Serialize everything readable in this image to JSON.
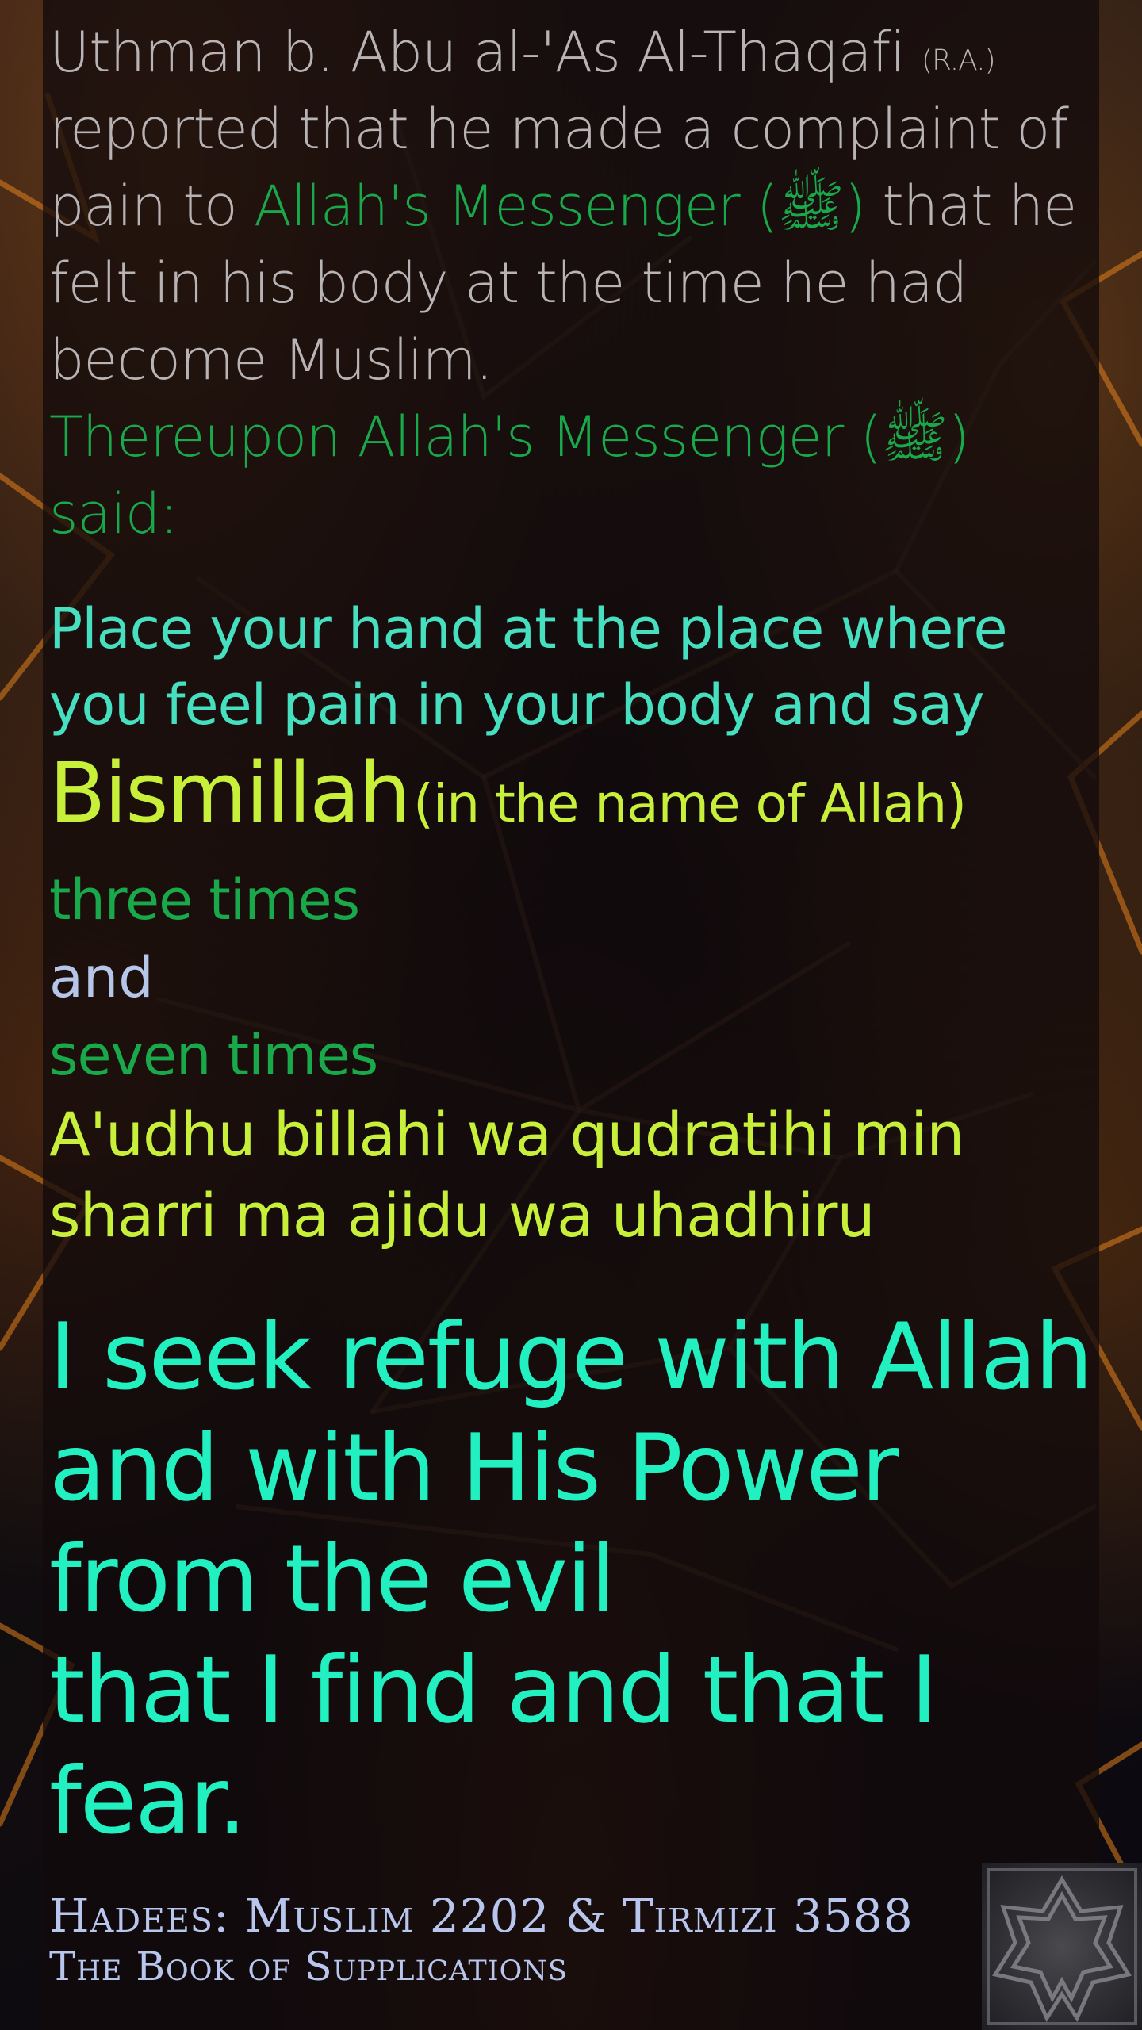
{
  "hadith": {
    "intro_a": "Uthman b. Abu al-'As Al-Thaqafi",
    "intro_honorific": "(R.A.)",
    "intro_b": "reported that he made a complaint of pain to",
    "messenger_1": "Allah's Messenger (ﷺ)",
    "intro_c": "that he felt in his body at the time he had become Muslim.",
    "thereupon": "Thereupon Allah's Messenger (ﷺ) said:",
    "instruction": "Place your hand at the place where you feel pain in your body and say",
    "bismillah": "Bismillah",
    "bismillah_meaning": "(in the name of Allah)",
    "count_1": "three times",
    "and": "and",
    "count_2": "seven times",
    "transliteration": "A'udhu billahi wa qudratihi min sharri ma ajidu wa uhadhiru",
    "meaning_line_1": "I seek refuge with Allah",
    "meaning_line_2": "and with His Power",
    "meaning_line_3": "from the evil",
    "meaning_line_4": "that I find and that I fear."
  },
  "reference": {
    "line_1": "Hadees: Muslim 2202 & Tirmizi 3588",
    "line_2": "The Book of Supplications"
  },
  "colors": {
    "intro_text": "#b8b4b6",
    "messenger_green": "#19a84a",
    "instruction_teal": "#46e0c0",
    "arabic_yellow": "#c8f03a",
    "meaning_teal": "#22f0c0",
    "reference_blue": "#b8c6ee",
    "background_accent": "#ff8a1e"
  },
  "icons": {
    "corner": "geometric-star-logo"
  }
}
